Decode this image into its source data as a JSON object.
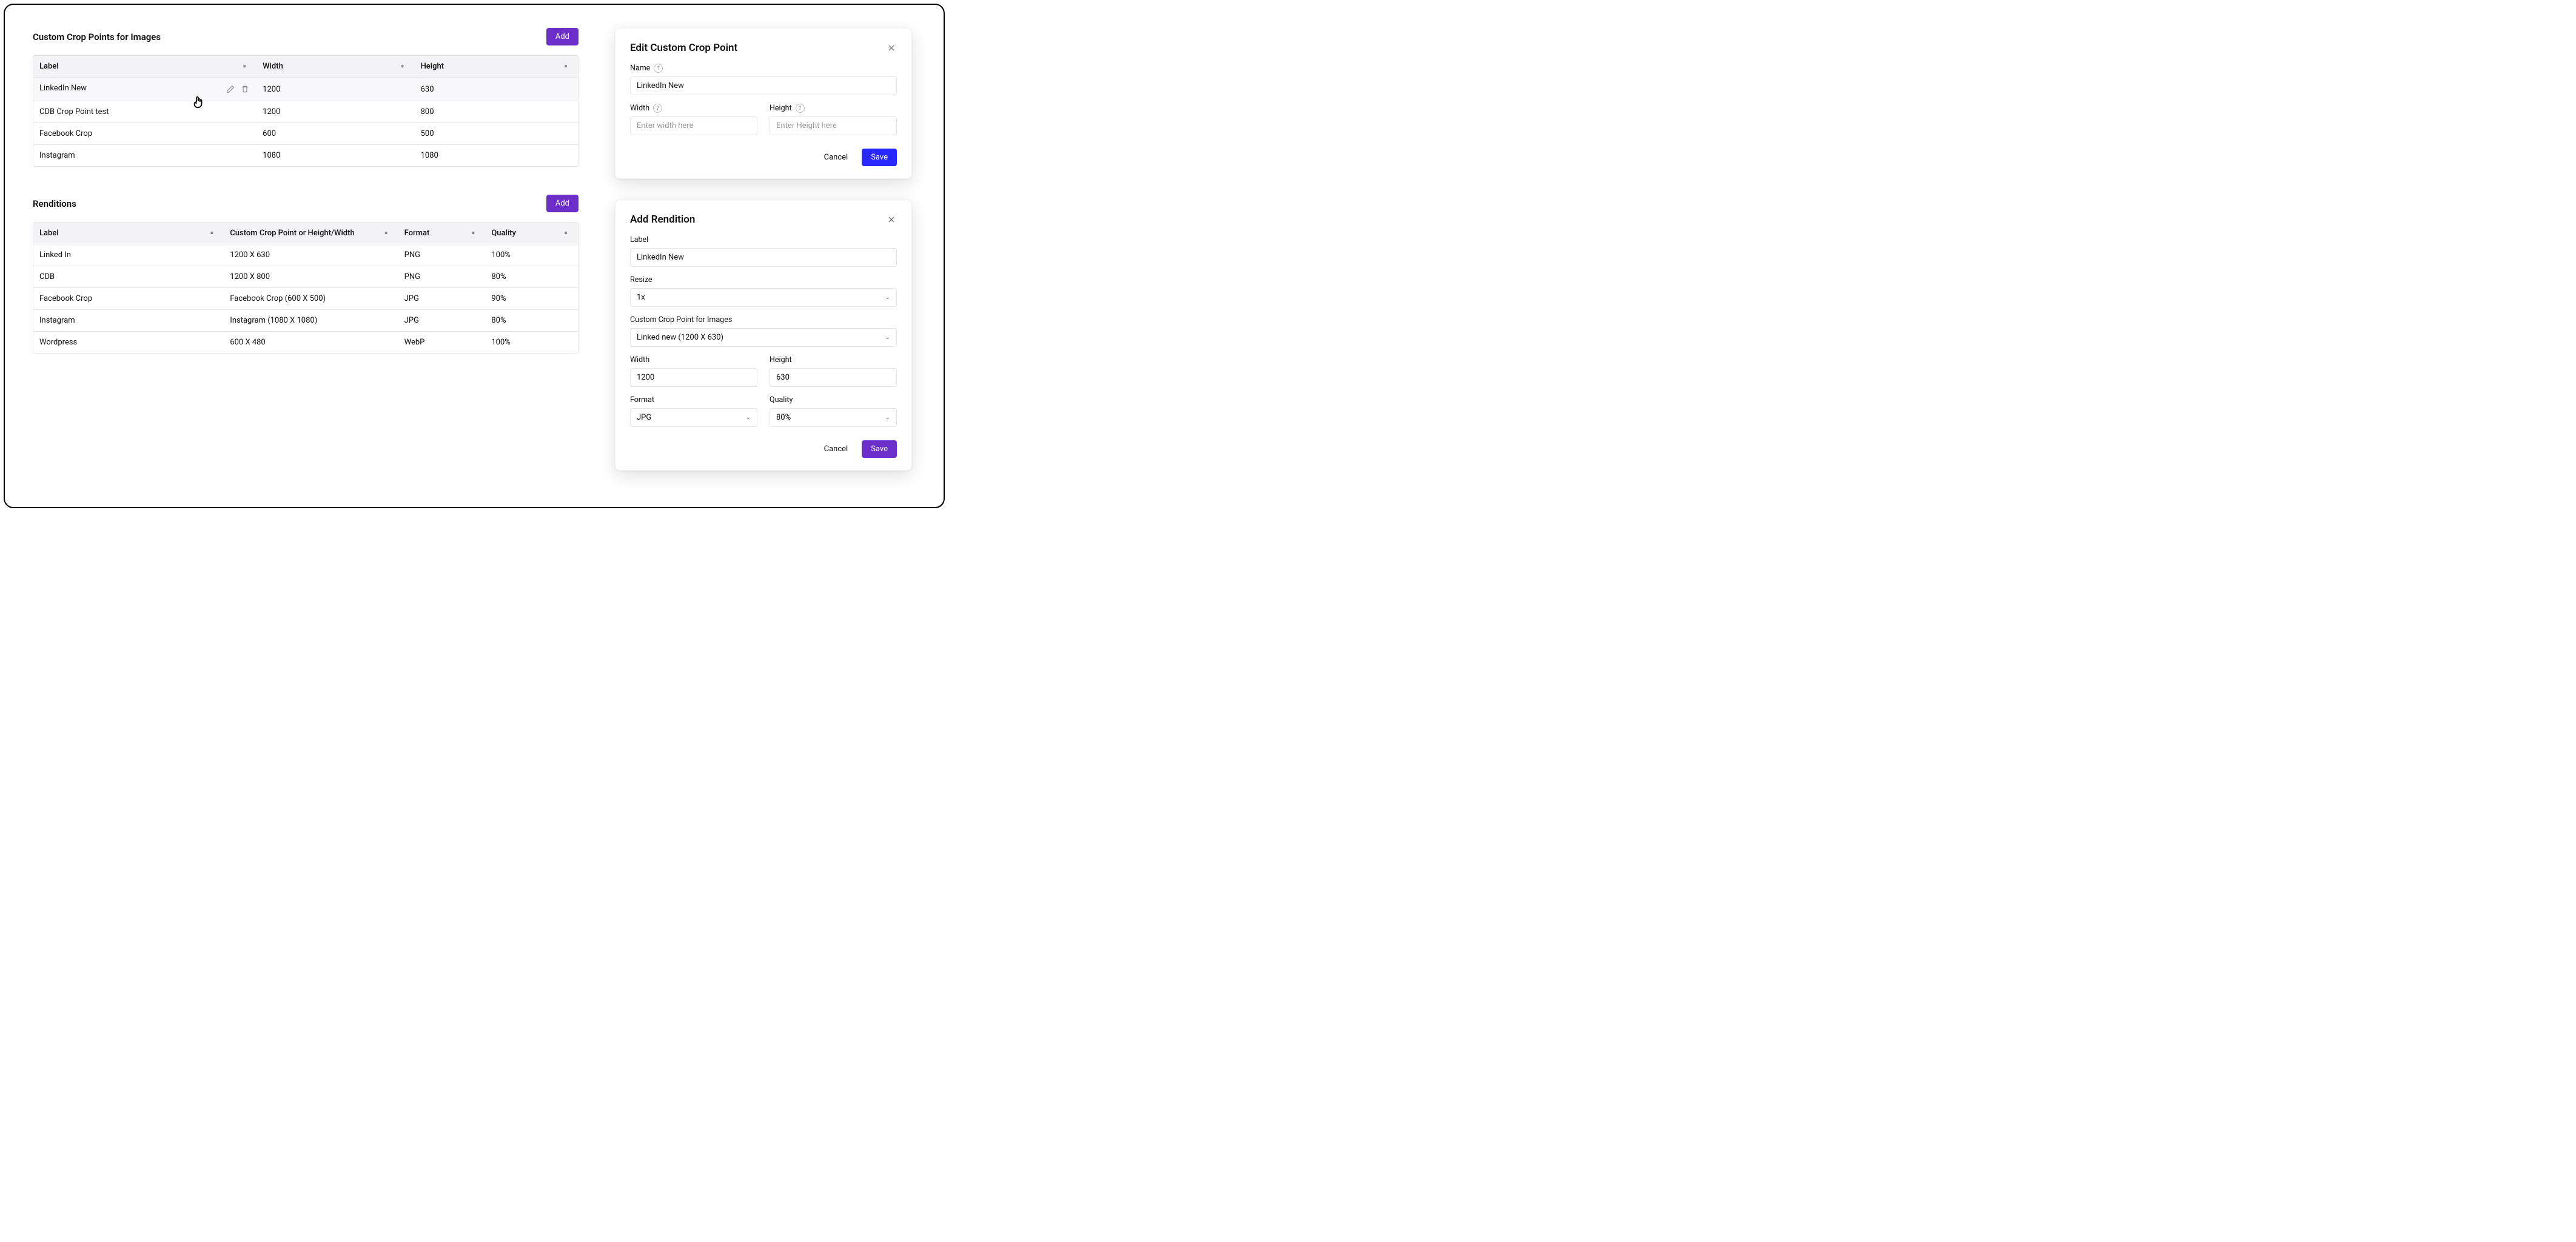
{
  "cropPoints": {
    "title": "Custom Crop Points for Images",
    "add_label": "Add",
    "columns": {
      "label": "Label",
      "width": "Width",
      "height": "Height"
    },
    "rows": [
      {
        "label": "LinkedIn New",
        "width": "1200",
        "height": "630"
      },
      {
        "label": "CDB Crop Point test",
        "width": "1200",
        "height": "800"
      },
      {
        "label": "Facebook Crop",
        "width": "600",
        "height": "500"
      },
      {
        "label": "Instagram",
        "width": "1080",
        "height": "1080"
      }
    ]
  },
  "renditions": {
    "title": "Renditions",
    "add_label": "Add",
    "columns": {
      "label": "Label",
      "crop": "Custom Crop Point or Height/Width",
      "format": "Format",
      "quality": "Quality"
    },
    "rows": [
      {
        "label": "Linked In",
        "crop": "1200 X 630",
        "format": "PNG",
        "quality": "100%"
      },
      {
        "label": "CDB",
        "crop": "1200 X 800",
        "format": "PNG",
        "quality": "80%"
      },
      {
        "label": "Facebook Crop",
        "crop": "Facebook Crop (600 X 500)",
        "format": "JPG",
        "quality": "90%"
      },
      {
        "label": "Instagram",
        "crop": "Instagram (1080 X 1080)",
        "format": "JPG",
        "quality": "80%"
      },
      {
        "label": "Wordpress",
        "crop": "600 X 480",
        "format": "WebP",
        "quality": "100%"
      }
    ]
  },
  "editPanel": {
    "title": "Edit Custom Crop Point",
    "name_label": "Name",
    "name_value": "LinkedIn New",
    "width_label": "Width",
    "width_placeholder": "Enter width here",
    "height_label": "Height",
    "height_placeholder": "Enter Height here",
    "cancel_label": "Cancel",
    "save_label": "Save"
  },
  "addRenditionPanel": {
    "title": "Add Rendition",
    "label_label": "Label",
    "label_value": "LinkedIn New",
    "resize_label": "Resize",
    "resize_value": "1x",
    "crop_label": "Custom Crop Point for Images",
    "crop_value": "Linked new (1200 X 630)",
    "width_label": "Width",
    "width_value": "1200",
    "height_label": "Height",
    "height_value": "630",
    "format_label": "Format",
    "format_value": "JPG",
    "quality_label": "Quality",
    "quality_value": "80%",
    "cancel_label": "Cancel",
    "save_label": "Save"
  }
}
